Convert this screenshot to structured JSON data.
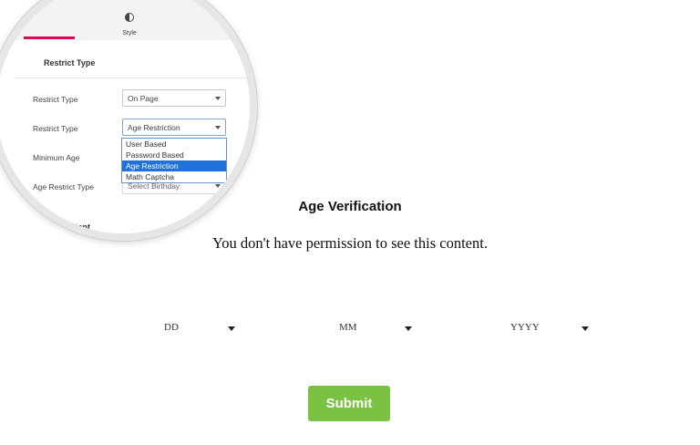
{
  "magnifier": {
    "tabs": {
      "style_label": "Style"
    },
    "section_title": "Restrict Type",
    "fields": [
      {
        "label": "Restrict Type",
        "value": "On Page"
      },
      {
        "label": "Restrict Type",
        "value": "Age Restriction"
      },
      {
        "label": "Minimum Age",
        "value": ""
      },
      {
        "label": "Age Restrict Type",
        "value": "Select Birthday"
      }
    ],
    "dropdown_options": [
      "User Based",
      "Password Based",
      "Age Restriction",
      "Math Captcha"
    ],
    "dropdown_selected": "Age Restriction",
    "next_section_title": "ict Content",
    "colors": {
      "tab_accent": "#d30c5c",
      "option_highlight": "#1e72d9"
    }
  },
  "main": {
    "heading": "Age Verification",
    "message": "You don't have permission to see this content.",
    "date_selects": [
      {
        "placeholder": "DD"
      },
      {
        "placeholder": "MM"
      },
      {
        "placeholder": "YYYY"
      }
    ],
    "submit_label": "Submit",
    "colors": {
      "submit_bg": "#7cc242",
      "submit_text": "#ffffff"
    }
  }
}
